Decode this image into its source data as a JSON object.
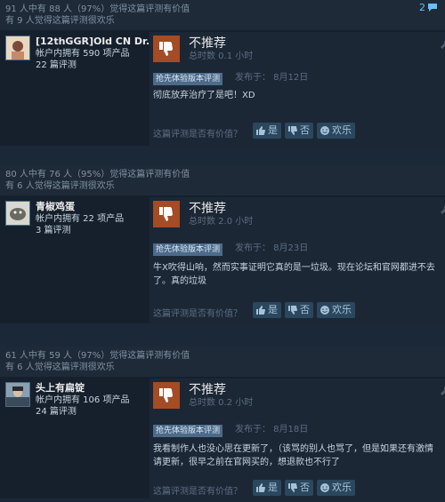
{
  "reviews": [
    {
      "helpful_line1": "91 人中有 88 人（97%）觉得这篇评测有价值",
      "helpful_line2": "有 9 人觉得这篇评测很欢乐",
      "comments": "2",
      "author": "[12thGGR]Old CN Dr.",
      "products": "帐户内拥有 590 项产品",
      "reviews_count": "22 篇评测",
      "verdict": "不推荐",
      "hours": "总时数 0.1 小时",
      "badge": "抢先体验版本评测",
      "posted": "发布于：  8月12日",
      "content": "彻底放弃治疗了是吧！XD"
    },
    {
      "helpful_line1": "80 人中有 76 人（95%）觉得这篇评测有价值",
      "helpful_line2": "有 6 人觉得这篇评测很欢乐",
      "author": "青椒鸡蛋",
      "products": "帐户内拥有 22 项产品",
      "reviews_count": "3 篇评测",
      "verdict": "不推荐",
      "hours": "总时数 2.0 小时",
      "badge": "抢先体验版本评测",
      "posted": "发布于：  8月23日",
      "content": "牛X吹得山响，然而实事证明它真的是一垃圾。现在论坛和官网都进不去了。真的垃圾"
    },
    {
      "helpful_line1": "61 人中有 59 人（97%）觉得这篇评测有价值",
      "helpful_line2": "有 6 人觉得这篇评测很欢乐",
      "author": "头上有扁锭",
      "products": "帐户内拥有 106 项产品",
      "reviews_count": "24 篇评测",
      "verdict": "不推荐",
      "hours": "总时数 0.2 小时",
      "badge": "抢先体验版本评测",
      "posted": "发布于：  8月18日",
      "content": "我看制作人也没心思在更新了，（该骂的别人也骂了，但是如果还有激情请更新，很早之前在官网买的，想退款也不行了"
    }
  ],
  "controls": {
    "question": "这篇评测是否有价值？",
    "yes": "是",
    "no": "否",
    "funny": "欢乐"
  },
  "colors": {
    "background": "#1b2838",
    "thumb_down_bg": "#a34c25",
    "link_blue": "#66c0f4"
  }
}
